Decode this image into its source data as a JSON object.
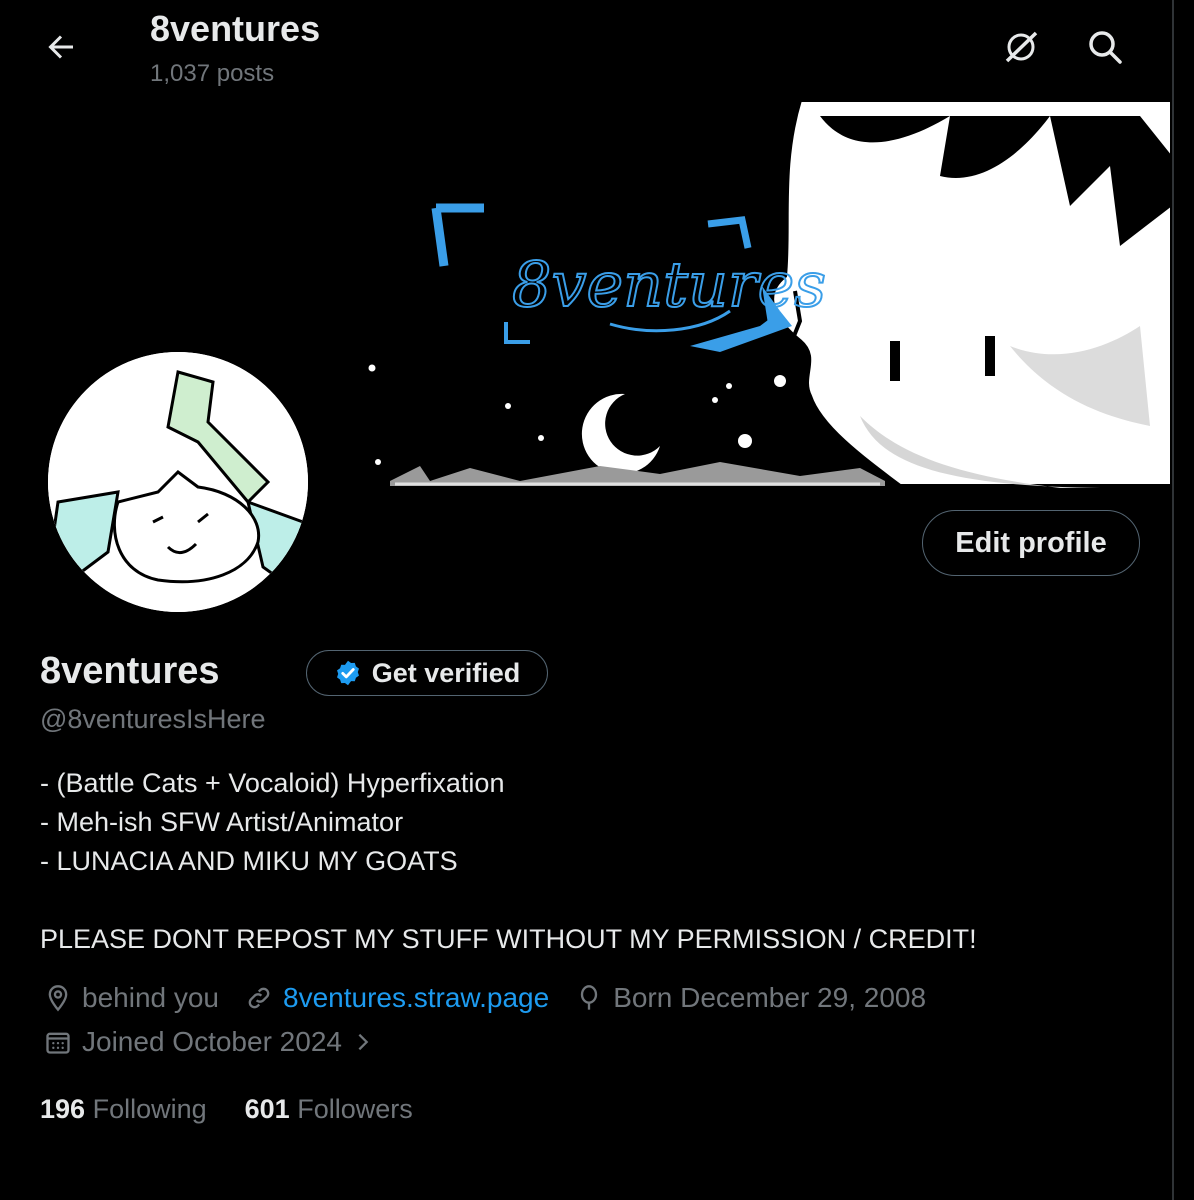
{
  "header": {
    "title": "8ventures",
    "posts_count": "1,037 posts",
    "icons": [
      "back-arrow-icon",
      "grok-icon",
      "search-icon"
    ]
  },
  "banner": {
    "art_text": "8ventures"
  },
  "profile": {
    "edit_label": "Edit profile",
    "name": "8ventures",
    "verify_label": "Get verified",
    "handle": "@8venturesIsHere",
    "bio": [
      "- (Battle Cats + Vocaloid) Hyperfixation",
      "- Meh-ish SFW Artist/Animator",
      "- LUNACIA AND MIKU MY GOATS",
      "",
      "PLEASE DONT REPOST MY STUFF WITHOUT MY PERMISSION / CREDIT!"
    ],
    "location": "behind you",
    "website": "8ventures.straw.page",
    "born": "Born December 29, 2008",
    "joined": "Joined October 2024"
  },
  "stats": {
    "following_count": "196",
    "following_label": "Following",
    "followers_count": "601",
    "followers_label": "Followers"
  },
  "colors": {
    "background": "#000000",
    "text": "#e7e9ea",
    "muted": "#71767b",
    "link": "#1d9bf0",
    "verified_badge": "#1d9bf0",
    "banner_accent": "#3a9ee8"
  }
}
